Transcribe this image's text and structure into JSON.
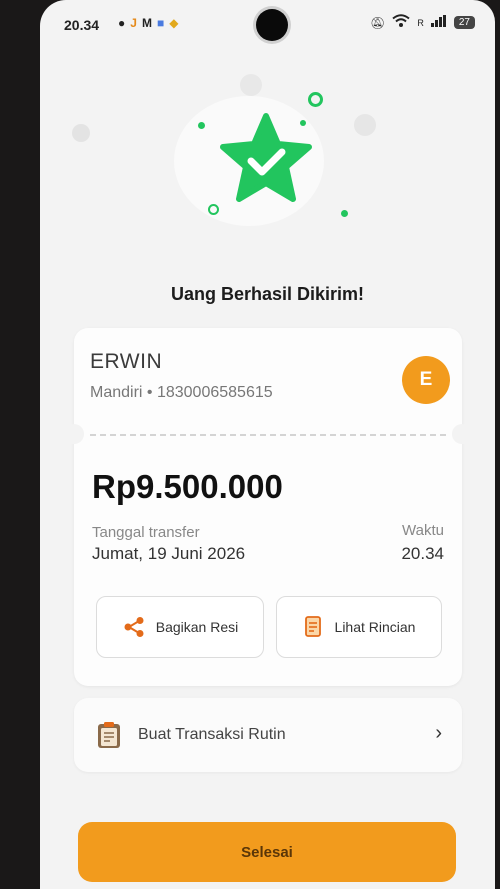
{
  "status_bar": {
    "time": "20.34",
    "carrier": "R",
    "battery": "27"
  },
  "title": "Uang Berhasil Dikirim!",
  "recipient": {
    "name": "ERWIN",
    "account": "Mandiri • 1830006585615",
    "avatar_initial": "E"
  },
  "amount": "Rp9.500.000",
  "transfer": {
    "date_label": "Tanggal transfer",
    "date": "Jumat, 19 Juni 2026",
    "time_label": "Waktu",
    "time": "20.34"
  },
  "actions": {
    "share": "Bagikan Resi",
    "details": "Lihat Rincian"
  },
  "routine": {
    "label": "Buat Transaksi Rutin"
  },
  "done_button": "Selesai",
  "colors": {
    "accent": "#f29b1d",
    "success": "#22c55e"
  }
}
